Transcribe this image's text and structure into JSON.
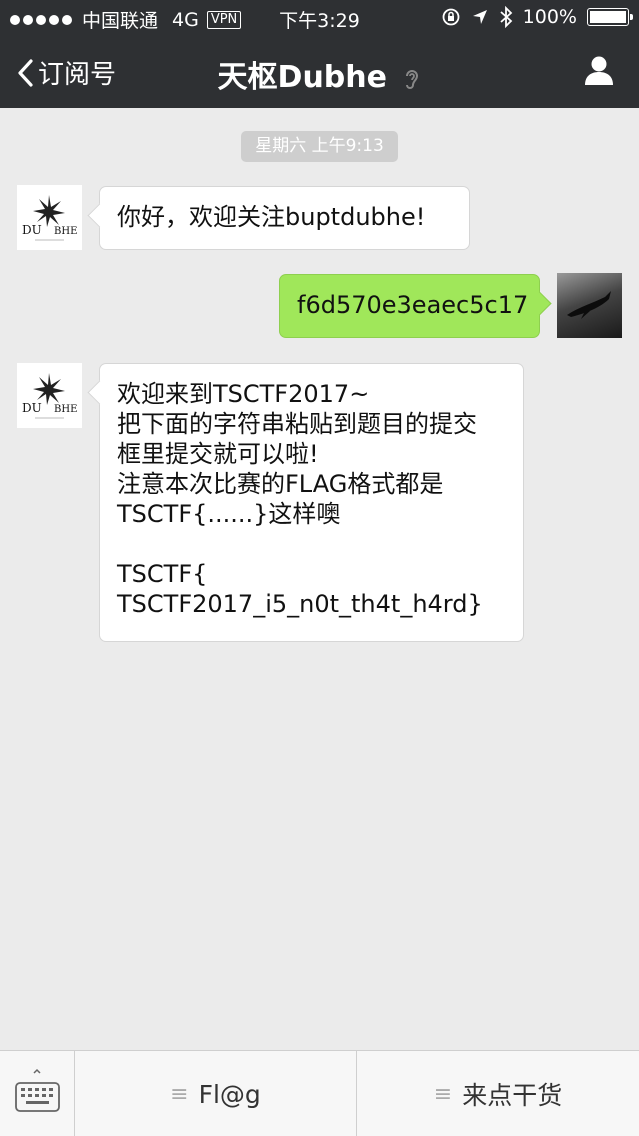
{
  "status_bar": {
    "carrier": "中国联通",
    "network": "4G",
    "vpn": "VPN",
    "time": "下午3:29",
    "battery": "100%",
    "battery_level": 1.0
  },
  "nav": {
    "back_label": "订阅号",
    "title": "天枢Dubhe"
  },
  "chat": {
    "timestamp": "星期六 上午9:13",
    "messages": [
      {
        "sender": "account",
        "lines": [
          "你好，欢迎关注buptdubhe!"
        ]
      },
      {
        "sender": "me",
        "lines": [
          "f6d570e3eaec5c17"
        ]
      },
      {
        "sender": "account",
        "lines": [
          "欢迎来到TSCTF2017~",
          "把下面的字符串粘贴到题目的提交",
          "框里提交就可以啦!",
          "注意本次比赛的FLAG格式都是",
          "TSCTF{......}这样噢",
          "",
          "TSCTF{",
          "TSCTF2017_i5_n0t_th4t_h4rd}"
        ]
      }
    ],
    "logo_text": "DUBHE"
  },
  "bottom_menu": {
    "items": [
      "Fl@g",
      "来点干货"
    ]
  }
}
